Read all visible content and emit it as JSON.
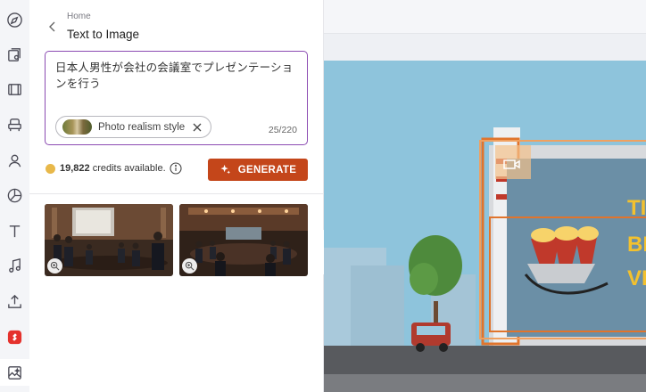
{
  "breadcrumb": {
    "home": "Home",
    "title": "Text to Image"
  },
  "prompt": {
    "text": "日本人男性が会社の会議室でプレゼンテーションを行う",
    "style_chip": "Photo realism style",
    "char_count": "25/220"
  },
  "credits": {
    "amount": "19,822",
    "suffix": " credits available."
  },
  "generate_label": "GENERATE",
  "rail_icons": [
    "compass-icon",
    "media-icon",
    "film-icon",
    "chair-icon",
    "person-icon",
    "chart-icon",
    "text-icon",
    "music-icon",
    "upload-icon",
    "app-icon",
    "ai-image-icon"
  ],
  "colors": {
    "accent": "#c4461a",
    "prompt_border": "#8b4bb2",
    "red_app": "#e5322d"
  },
  "results": [
    {
      "name": "result-image-1",
      "zoom_icon": "zoom-in-icon"
    },
    {
      "name": "result-image-2",
      "zoom_icon": "zoom-in-icon"
    }
  ],
  "canvas": {
    "headline_partial": [
      "TI",
      "BI",
      "VI"
    ]
  }
}
